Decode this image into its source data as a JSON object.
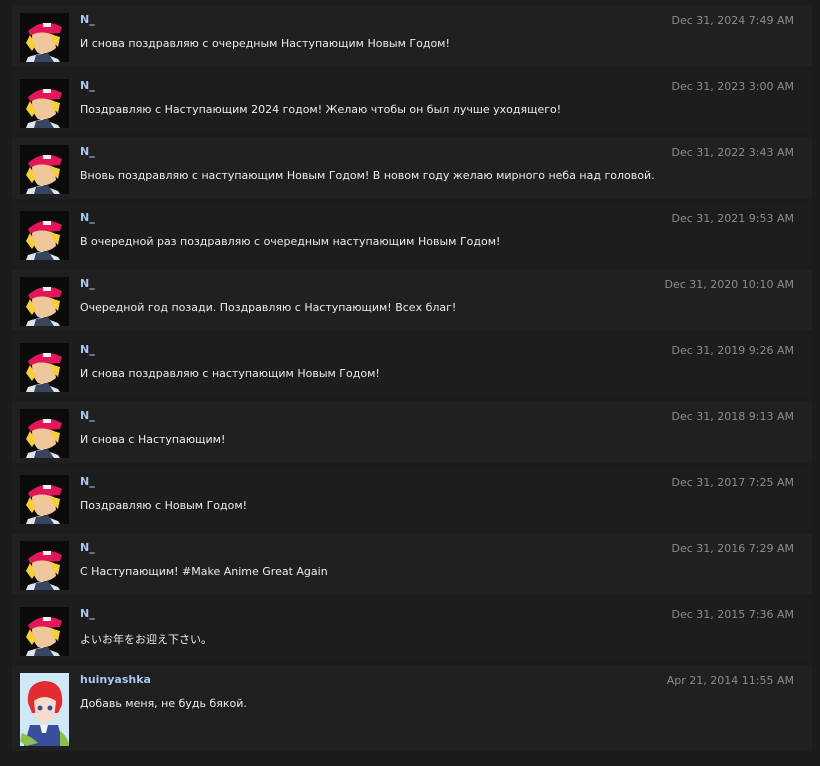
{
  "comments": [
    {
      "author": "N_",
      "date": "Dec 31, 2024 7:49 AM",
      "text": "И снова поздравляю с очередным Наступающим Новым Годом!",
      "avatar": "red-cap-character-avatar"
    },
    {
      "author": "N_",
      "date": "Dec 31, 2023 3:00 AM",
      "text": "Поздравляю с Наступающим 2024 годом! Желаю чтобы он был лучше уходящего!",
      "avatar": "red-cap-character-avatar"
    },
    {
      "author": "N_",
      "date": "Dec 31, 2022 3:43 AM",
      "text": "Вновь поздравляю с наступающим Новым Годом! В новом году желаю мирного неба над головой.",
      "avatar": "red-cap-character-avatar"
    },
    {
      "author": "N_",
      "date": "Dec 31, 2021 9:53 AM",
      "text": "В очередной раз поздравляю с очередным наступающим Новым Годом!",
      "avatar": "red-cap-character-avatar"
    },
    {
      "author": "N_",
      "date": "Dec 31, 2020 10:10 AM",
      "text": "Очередной год позади. Поздравляю с Наступающим! Всех благ!",
      "avatar": "red-cap-character-avatar"
    },
    {
      "author": "N_",
      "date": "Dec 31, 2019 9:26 AM",
      "text": "И снова поздравляю с наступающим Новым Годом!",
      "avatar": "red-cap-character-avatar"
    },
    {
      "author": "N_",
      "date": "Dec 31, 2018 9:13 AM",
      "text": "И снова с Наступающим!",
      "avatar": "red-cap-character-avatar"
    },
    {
      "author": "N_",
      "date": "Dec 31, 2017 7:25 AM",
      "text": "Поздравляю с Новым Годом!",
      "avatar": "red-cap-character-avatar"
    },
    {
      "author": "N_",
      "date": "Dec 31, 2016 7:29 AM",
      "text": "С Наступающим! #Make Anime Great Again",
      "avatar": "red-cap-character-avatar"
    },
    {
      "author": "N_",
      "date": "Dec 31, 2015 7:36 AM",
      "text": "よいお年をお迎え下さい。",
      "avatar": "red-cap-character-avatar"
    },
    {
      "author": "huinyashka",
      "date": "Apr 21, 2014 11:55 AM",
      "text": "Добавь меня, не будь бякой.",
      "avatar": "red-haired-girl-avatar"
    }
  ],
  "colors": {
    "background": "#1b1b1b",
    "row": "#202020",
    "author": "#a6c8f0",
    "date": "#8c8c8c",
    "text": "#ececec"
  }
}
